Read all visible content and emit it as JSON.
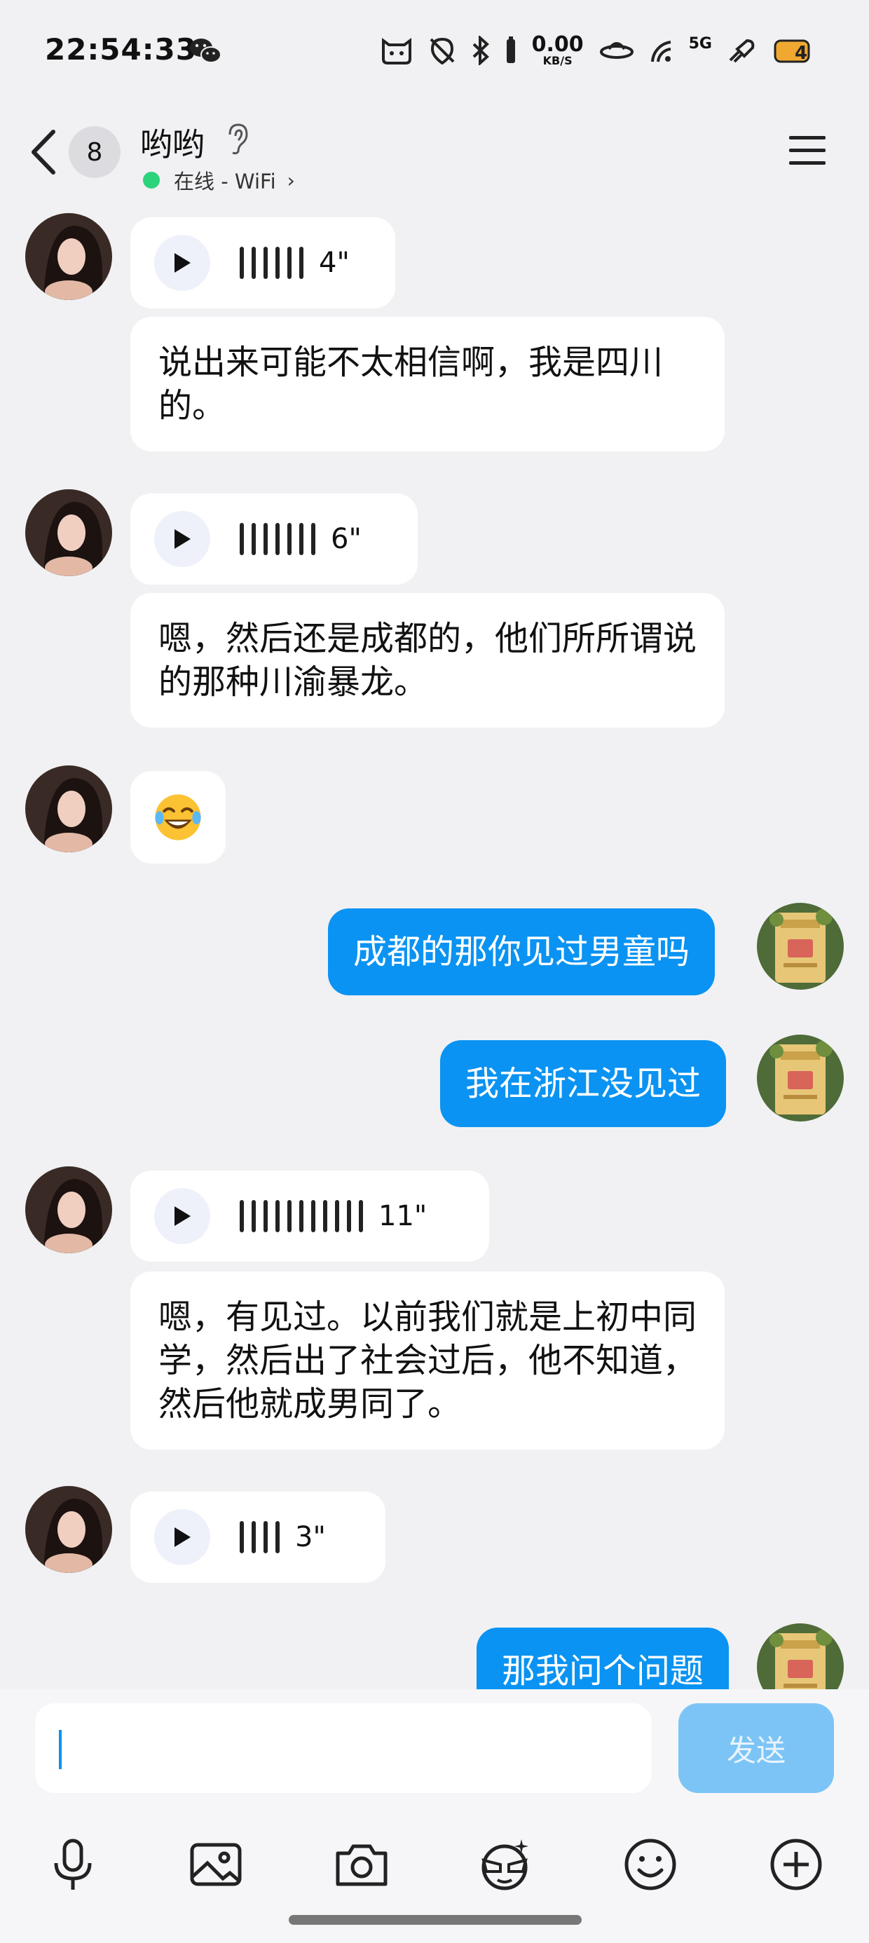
{
  "status_bar": {
    "time": "22:54:33",
    "net_speed_value": "0.00",
    "net_speed_unit": "KB/S",
    "signal_label": "5G",
    "icons": [
      "wechat-icon",
      "cat-face-icon",
      "no-location-icon",
      "bluetooth-icon",
      "battery-icon",
      "data-arrows-icon",
      "signal-icon",
      "rocket-icon",
      "pet-icon"
    ]
  },
  "header": {
    "unread_count": "8",
    "contact_name": "哟哟",
    "online_status": "在线 - WiFi"
  },
  "messages": [
    {
      "side": "left",
      "type": "voice",
      "duration": "4\""
    },
    {
      "side": "left",
      "type": "text",
      "text": "说出来可能不太相信啊，我是四川的。"
    },
    {
      "side": "left",
      "type": "voice",
      "duration": "6\""
    },
    {
      "side": "left",
      "type": "text",
      "text": "嗯，然后还是成都的，他们所所谓说的那种川渝暴龙。"
    },
    {
      "side": "left",
      "type": "emoji",
      "emoji": "😂"
    },
    {
      "side": "right",
      "type": "text",
      "text": "成都的那你见过男童吗"
    },
    {
      "side": "right",
      "type": "text",
      "text": "我在浙江没见过"
    },
    {
      "side": "left",
      "type": "voice",
      "duration": "11\""
    },
    {
      "side": "left",
      "type": "text",
      "text": "嗯，有见过。以前我们就是上初中同学，然后出了社会过后，他不知道，然后他就成男同了。"
    },
    {
      "side": "left",
      "type": "voice",
      "duration": "3\""
    },
    {
      "side": "right",
      "type": "text",
      "text": "那我问个问题"
    }
  ],
  "input": {
    "value": "",
    "send_label": "发送"
  },
  "toolbar": [
    "microphone-icon",
    "image-icon",
    "camera-icon",
    "sticker-face-icon",
    "emoji-icon",
    "plus-icon"
  ],
  "colors": {
    "background": "#f1f1f3",
    "sent_bubble": "#0a93f2",
    "online_dot": "#2dd37a",
    "send_button": "#7cc4f6"
  }
}
